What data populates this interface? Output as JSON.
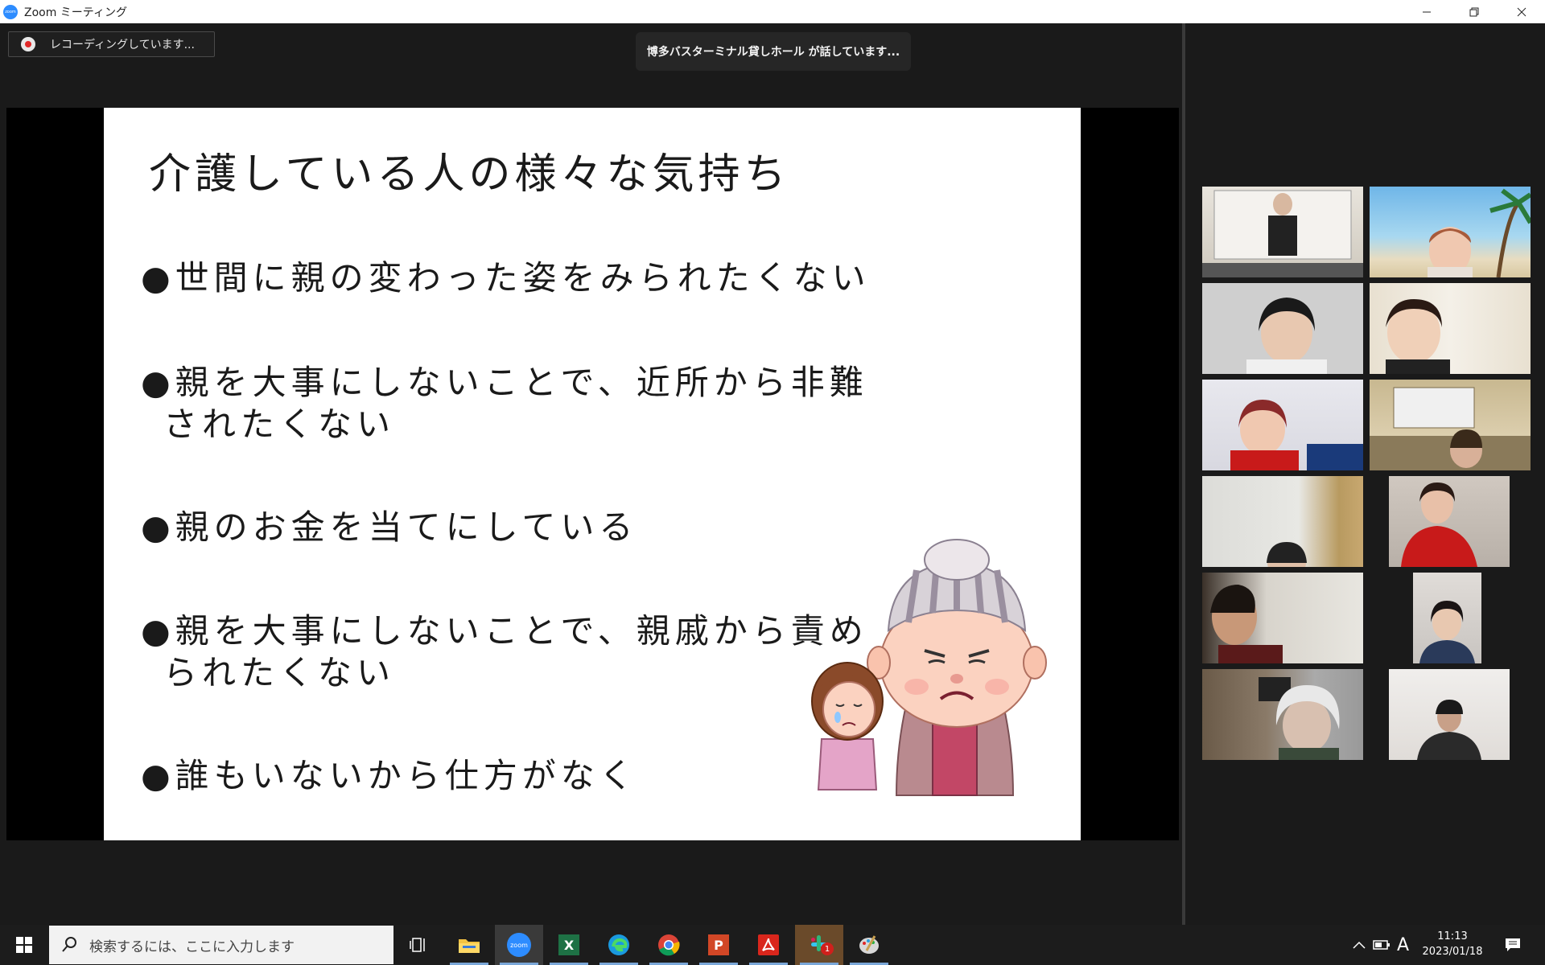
{
  "window": {
    "title": "Zoom ミーティング",
    "logo_text": "zoom"
  },
  "recording": {
    "label": "レコーディングしています..."
  },
  "speaker": {
    "label": "博多バスターミナル貸しホール が話しています..."
  },
  "slide": {
    "title": "介護している人の様々な気持ち",
    "bullets": [
      {
        "line1": "●世間に親の変わった姿をみられたくない",
        "line2": ""
      },
      {
        "line1": "●親を大事にしないことで、近所から非難",
        "line2": "されたくない"
      },
      {
        "line1": "●親のお金を当てにしている",
        "line2": ""
      },
      {
        "line1": "●親を大事にしないことで、親戚から責め",
        "line2": "られたくない"
      },
      {
        "line1": "●誰もいないから仕方がなく",
        "line2": ""
      }
    ]
  },
  "taskbar": {
    "search_placeholder": "検索するには、ここに入力します",
    "zoom_label": "zoom",
    "excel_label": "X",
    "powerpoint_label": "P",
    "notification_badge": "1",
    "ime_label": "A",
    "time": "11:13",
    "date": "2023/01/18"
  },
  "colors": {
    "zoom_blue": "#2d8cff",
    "recording_red": "#e02828",
    "background": "#1a1a1a"
  }
}
